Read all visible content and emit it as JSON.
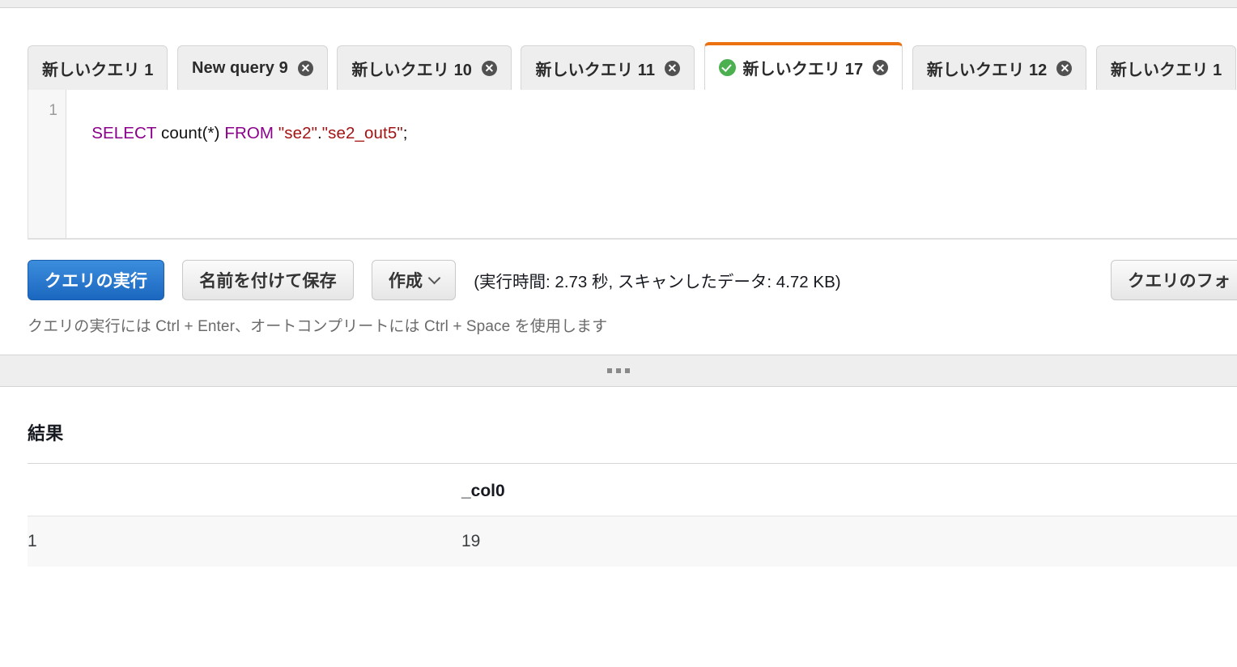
{
  "tabs": [
    {
      "label": "新しいクエリ 1",
      "closable": false,
      "active": false,
      "status": null
    },
    {
      "label": "New query 9",
      "closable": true,
      "active": false,
      "status": null
    },
    {
      "label": "新しいクエリ 10",
      "closable": true,
      "active": false,
      "status": null
    },
    {
      "label": "新しいクエリ 11",
      "closable": true,
      "active": false,
      "status": null
    },
    {
      "label": "新しいクエリ 17",
      "closable": true,
      "active": true,
      "status": "success-check-icon"
    },
    {
      "label": "新しいクエリ 12",
      "closable": true,
      "active": false,
      "status": null
    },
    {
      "label": "新しいクエリ 1",
      "closable": false,
      "active": false,
      "status": null
    }
  ],
  "editor": {
    "line_number": "1",
    "sql_tokens": [
      {
        "text": "SELECT",
        "type": "keyword"
      },
      {
        "text": " count(*) ",
        "type": "plain"
      },
      {
        "text": "FROM",
        "type": "keyword"
      },
      {
        "text": " ",
        "type": "plain"
      },
      {
        "text": "\"se2\"",
        "type": "string"
      },
      {
        "text": ".",
        "type": "plain"
      },
      {
        "text": "\"se2_out5\"",
        "type": "string"
      },
      {
        "text": ";",
        "type": "plain"
      }
    ],
    "sql_text": "SELECT count(*) FROM \"se2\".\"se2_out5\";"
  },
  "actions": {
    "run_label": "クエリの実行",
    "save_as_label": "名前を付けて保存",
    "create_label": "作成",
    "format_label": "クエリのフォ",
    "exec_stats": "(実行時間: 2.73 秒, スキャンしたデータ: 4.72 KB)",
    "exec_time": "2.73 秒",
    "data_scanned": "4.72 KB"
  },
  "hint": "クエリの実行には Ctrl + Enter、オートコンプリートには Ctrl + Space を使用します",
  "results": {
    "title": "結果",
    "columns": [
      "",
      "_col0"
    ],
    "rows": [
      {
        "index": "1",
        "col0": "19"
      }
    ]
  },
  "colors": {
    "accent_orange": "#ec7211",
    "primary_blue": "#1b67c0",
    "success_green": "#4caf50",
    "sql_keyword": "#8b008b",
    "sql_string": "#a31515"
  }
}
